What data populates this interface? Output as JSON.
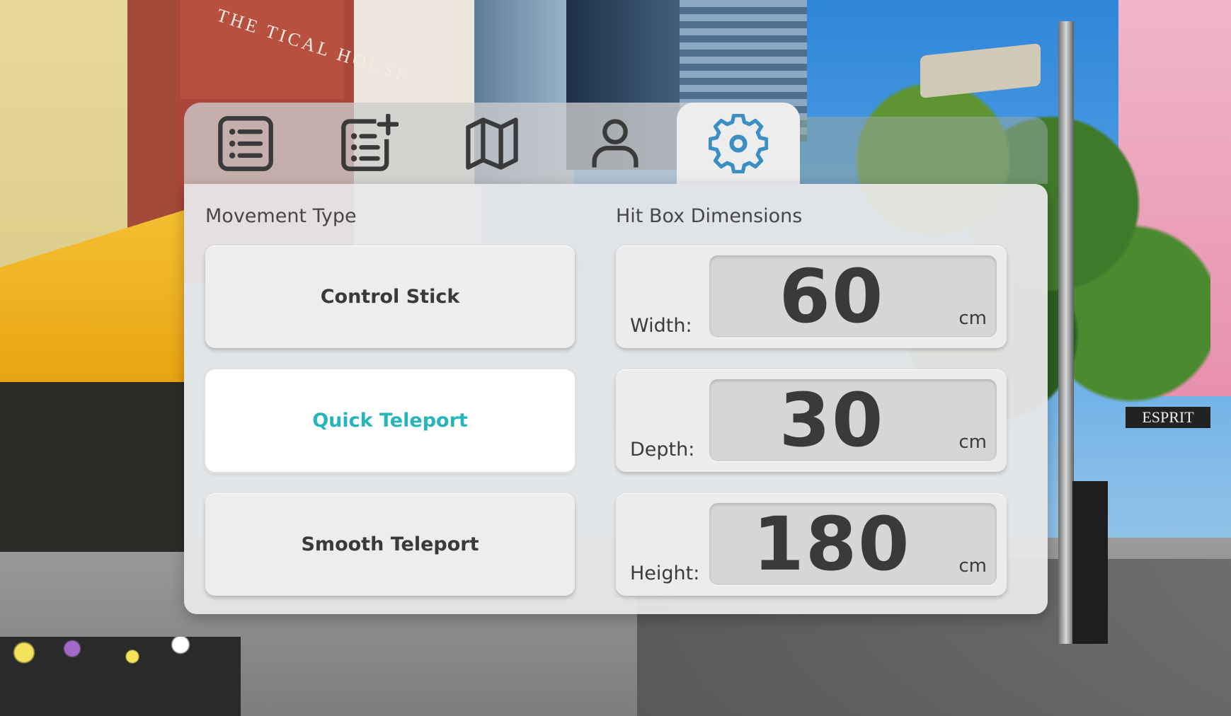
{
  "tabs": [
    {
      "icon": "list-icon",
      "active": false
    },
    {
      "icon": "add-list-icon",
      "active": false
    },
    {
      "icon": "map-icon",
      "active": false
    },
    {
      "icon": "user-icon",
      "active": false
    },
    {
      "icon": "settings-gear-icon",
      "active": true
    }
  ],
  "colors": {
    "accent": "#25b6b9",
    "active_tab_icon": "#3b8fc4",
    "icon": "#3a3a3a"
  },
  "movement": {
    "title": "Movement Type",
    "options": [
      {
        "label": "Control Stick",
        "selected": false
      },
      {
        "label": "Quick Teleport",
        "selected": true
      },
      {
        "label": "Smooth Teleport",
        "selected": false
      }
    ]
  },
  "hitbox": {
    "title": "Hit Box Dimensions",
    "dimensions": [
      {
        "label": "Width:",
        "value": "60",
        "unit": "cm"
      },
      {
        "label": "Depth:",
        "value": "30",
        "unit": "cm"
      },
      {
        "label": "Height:",
        "value": "180",
        "unit": "cm"
      }
    ]
  },
  "background": {
    "building_sign": "THE TICAL HOUSE",
    "shop_sign": "ESPRIT"
  }
}
